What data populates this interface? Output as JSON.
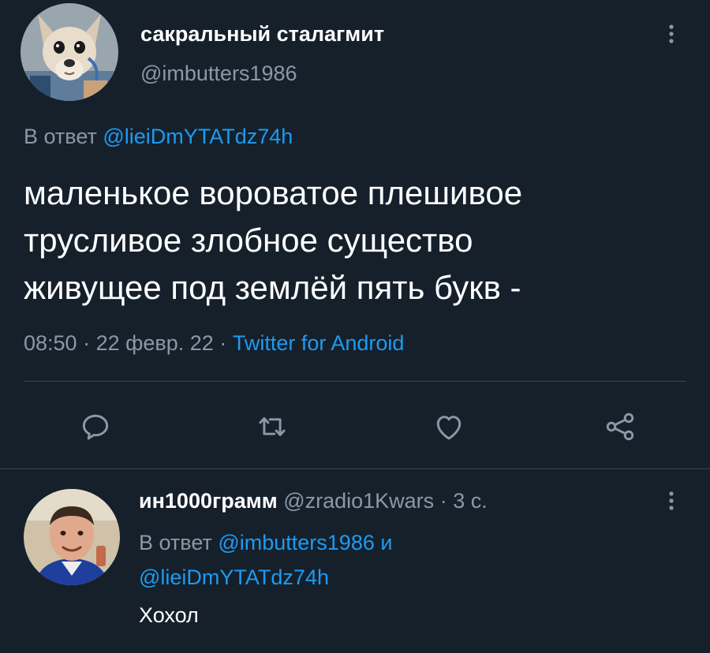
{
  "tweet": {
    "author_name": "сакральный сталагмит",
    "author_handle": "@imbutters1986",
    "reply_prefix": "В ответ",
    "reply_mention": "@lieiDmYTATdz74h",
    "text_lines": [
      "маленькое вороватое плешивое",
      "трусливое злобное существо",
      "живущее под землёй пять букв -"
    ],
    "time": "08:50",
    "date": "22 февр. 22",
    "separator": "·",
    "source": "Twitter for Android",
    "avatar_icon": "dog-avatar",
    "actions": [
      {
        "icon": "reply-icon"
      },
      {
        "icon": "retweet-icon"
      },
      {
        "icon": "like-icon"
      },
      {
        "icon": "share-icon"
      }
    ]
  },
  "reply": {
    "author_name": "ин1000грамм",
    "author_handle": "@zradio1Kwars",
    "separator": "·",
    "time_ago": "3 с.",
    "reply_prefix": "В ответ",
    "mention_1": "@imbutters1986",
    "conjunction": "и",
    "mention_2": "@lieiDmYTATdz74h",
    "text": "Хохол",
    "avatar_icon": "man-avatar"
  },
  "colors": {
    "background": "#15202b",
    "text": "#ffffff",
    "secondary": "#8b98a5",
    "link": "#1d9bf0",
    "divider": "#38444d"
  }
}
